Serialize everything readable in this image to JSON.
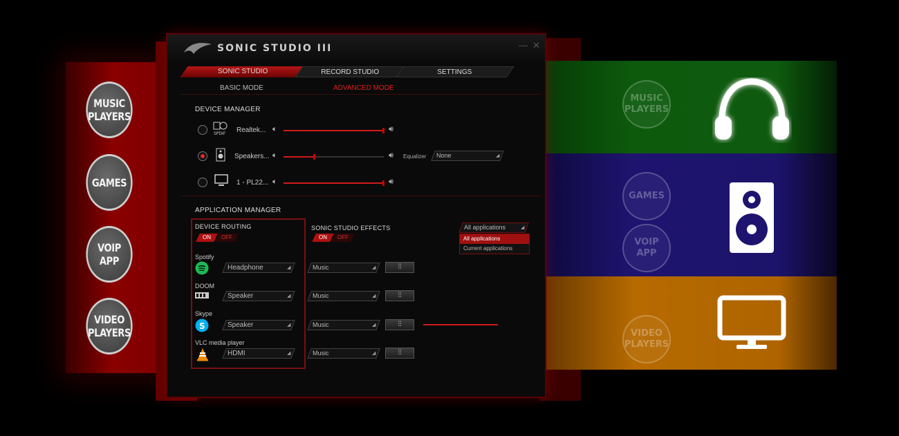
{
  "left_categories": [
    "MUSIC\nPLAYERS",
    "GAMES",
    "VOIP\nAPP",
    "VIDEO\nPLAYERS"
  ],
  "right_ghost_categories": [
    "MUSIC\nPLAYERS",
    "GAMES",
    "VOIP\nAPP",
    "VIDEO\nPLAYERS"
  ],
  "right_icons": [
    "headphones-icon",
    "speaker-icon",
    "monitor-icon"
  ],
  "colors": {
    "green_band": "#0d5a0d",
    "purple_band": "#1e1470",
    "orange_band": "#b66a00",
    "accent_red": "#d21a1a"
  },
  "window": {
    "title": "SONIC STUDIO III",
    "tabs": [
      "SONIC STUDIO",
      "RECORD STUDIO",
      "SETTINGS"
    ],
    "modes": [
      "BASIC MODE",
      "ADVANCED MODE"
    ],
    "active_mode": "ADVANCED MODE"
  },
  "device_manager": {
    "title": "DEVICE MANAGER",
    "devices": [
      {
        "name": "Realtek...",
        "icon": "spdif-icon",
        "selected": false,
        "volume": 1.0
      },
      {
        "name": "Speakers...",
        "icon": "speaker-icon",
        "selected": true,
        "volume": 0.3
      },
      {
        "name": "1 - PL22...",
        "icon": "monitor-icon",
        "selected": false,
        "volume": 1.0
      }
    ],
    "equalizer_label": "Equalizer",
    "equalizer_value": "None"
  },
  "app_manager": {
    "title": "APPLICATION MANAGER",
    "device_routing": "DEVICE ROUTING",
    "effects": "SONIC STUDIO EFFECTS",
    "on": "ON",
    "off": "OFF",
    "filter_value": "All applications",
    "filter_options": [
      "All applications",
      "Current applications"
    ],
    "apps": [
      {
        "name": "Spotify",
        "icon": "spotify-icon",
        "route": "Headphone",
        "effect": "Music"
      },
      {
        "name": "DOOM",
        "icon": "doom-icon",
        "route": "Speaker",
        "effect": "Music"
      },
      {
        "name": "Skype",
        "icon": "skype-icon",
        "route": "Speaker",
        "effect": "Music"
      },
      {
        "name": "VLC media player",
        "icon": "vlc-icon",
        "route": "HDMI",
        "effect": "Music"
      }
    ]
  }
}
